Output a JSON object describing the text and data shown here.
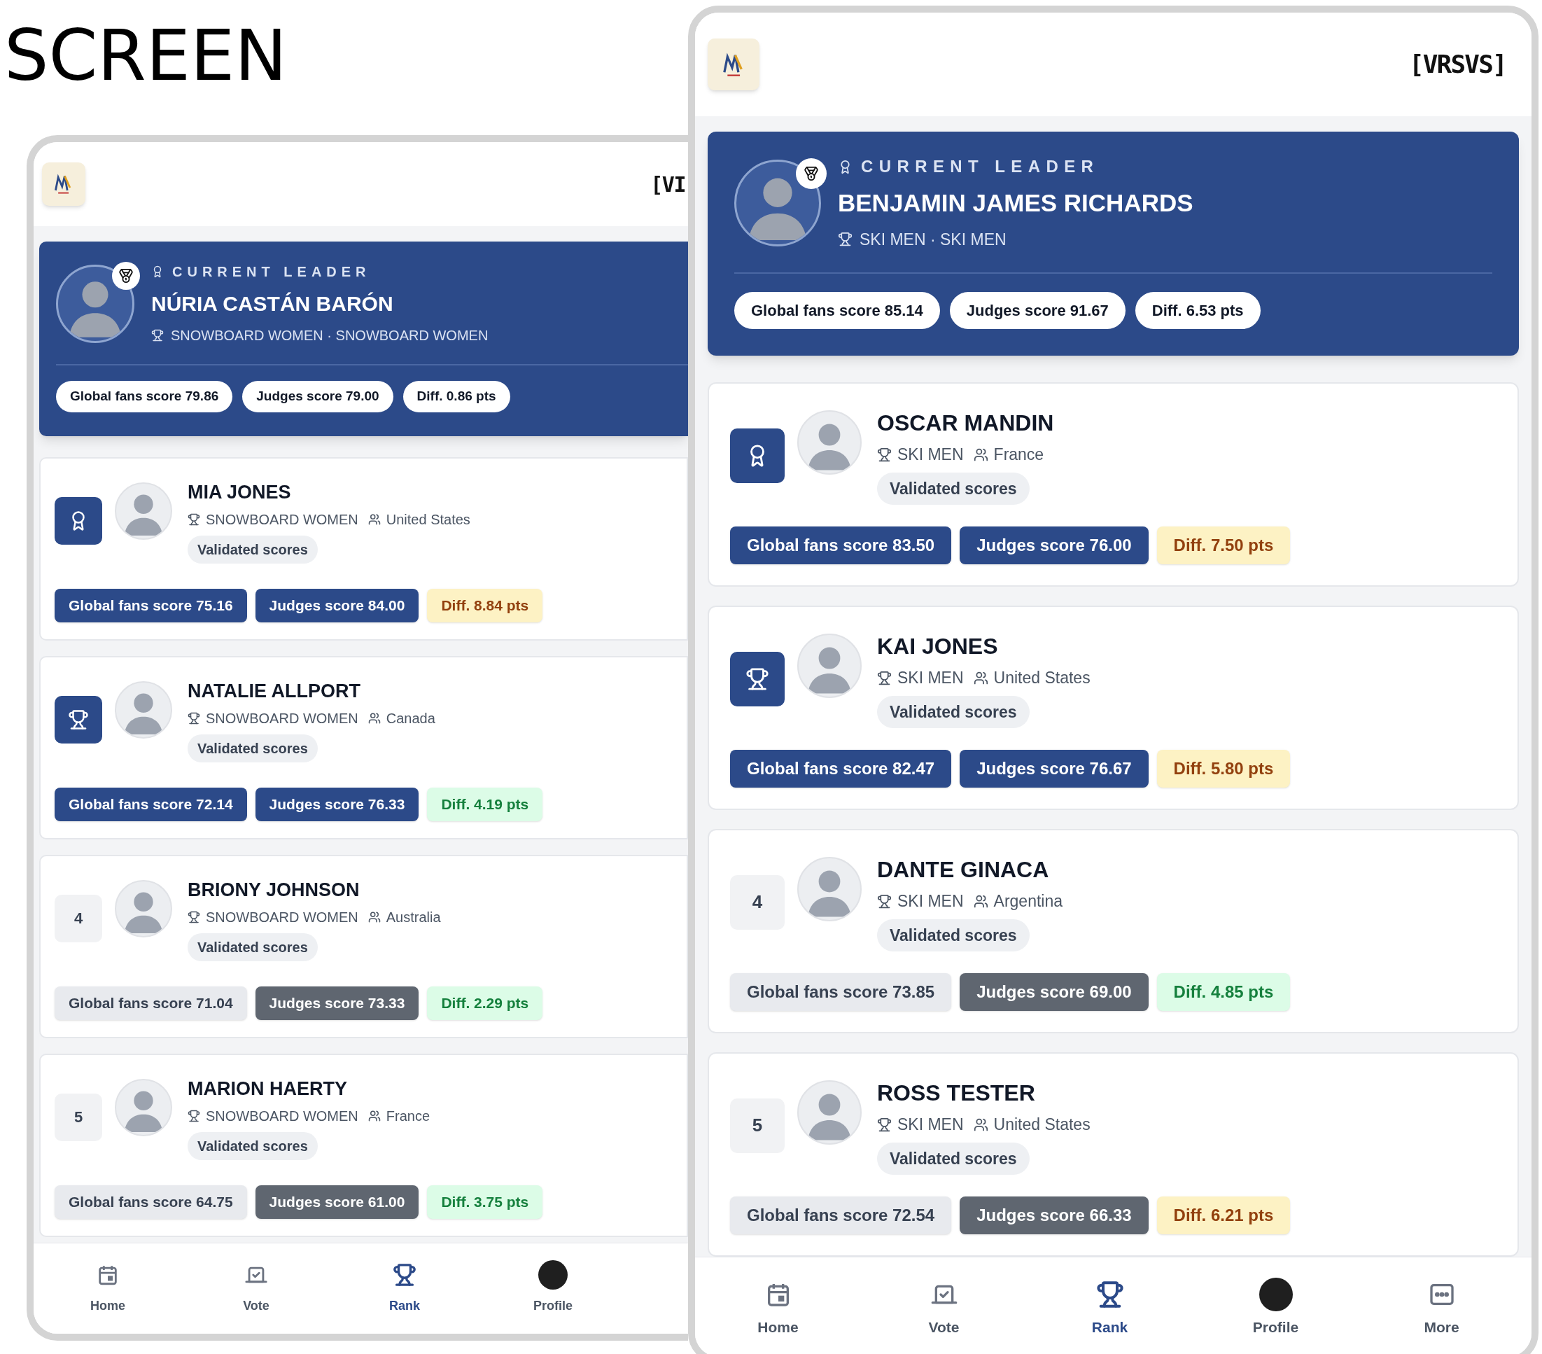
{
  "title": "SCREEN",
  "phones": [
    {
      "kind": "compact",
      "logo": "[VI",
      "leader": {
        "label": "CURRENT LEADER",
        "name": "NÚRIA CASTÁN BARÓN",
        "meta": "SNOWBOARD WOMEN · SNOWBOARD WOMEN",
        "scores": [
          "Global fans score 79.86",
          "Judges score 79.00",
          "Diff. 0.86 pts"
        ]
      },
      "rows": [
        {
          "rank": {
            "kind": "award"
          },
          "name": "MIA JONES",
          "sport": "SNOWBOARD WOMEN",
          "country": "United States",
          "status": "Validated scores",
          "global": {
            "text": "Global fans score 75.16",
            "kind": "blue"
          },
          "judges": {
            "text": "Judges score 84.00",
            "kind": "blue"
          },
          "diff": {
            "text": "Diff. 8.84 pts",
            "kind": "yellow"
          }
        },
        {
          "rank": {
            "kind": "trophy"
          },
          "name": "NATALIE ALLPORT",
          "sport": "SNOWBOARD WOMEN",
          "country": "Canada",
          "status": "Validated scores",
          "global": {
            "text": "Global fans score 72.14",
            "kind": "blue"
          },
          "judges": {
            "text": "Judges score 76.33",
            "kind": "blue"
          },
          "diff": {
            "text": "Diff. 4.19 pts",
            "kind": "green"
          }
        },
        {
          "rank": {
            "kind": "number",
            "label": "4"
          },
          "name": "BRIONY JOHNSON",
          "sport": "SNOWBOARD WOMEN",
          "country": "Australia",
          "status": "Validated scores",
          "global": {
            "text": "Global fans score 71.04",
            "kind": "light"
          },
          "judges": {
            "text": "Judges score 73.33",
            "kind": "dark"
          },
          "diff": {
            "text": "Diff. 2.29 pts",
            "kind": "green"
          }
        },
        {
          "rank": {
            "kind": "number",
            "label": "5"
          },
          "name": "MARION HAERTY",
          "sport": "SNOWBOARD WOMEN",
          "country": "France",
          "status": "Validated scores",
          "global": {
            "text": "Global fans score 64.75",
            "kind": "light"
          },
          "judges": {
            "text": "Judges score 61.00",
            "kind": "dark"
          },
          "diff": {
            "text": "Diff. 3.75 pts",
            "kind": "green"
          }
        }
      ],
      "nav": [
        {
          "kind": "calendar",
          "label": "Home",
          "selected": false
        },
        {
          "kind": "vote",
          "label": "Vote",
          "selected": false
        },
        {
          "kind": "trophy",
          "label": "Rank",
          "selected": true
        },
        {
          "kind": "avatar",
          "label": "Profile",
          "selected": false
        }
      ]
    },
    {
      "kind": "full",
      "logo": "[VRSVS]",
      "leader": {
        "label": "CURRENT LEADER",
        "name": "BENJAMIN JAMES RICHARDS",
        "meta": "SKI MEN · SKI MEN",
        "scores": [
          "Global fans score 85.14",
          "Judges score 91.67",
          "Diff. 6.53 pts"
        ]
      },
      "rows": [
        {
          "rank": {
            "kind": "award"
          },
          "name": "OSCAR MANDIN",
          "sport": "SKI MEN",
          "country": "France",
          "status": "Validated scores",
          "global": {
            "text": "Global fans score 83.50",
            "kind": "blue"
          },
          "judges": {
            "text": "Judges score 76.00",
            "kind": "blue"
          },
          "diff": {
            "text": "Diff. 7.50 pts",
            "kind": "yellow"
          }
        },
        {
          "rank": {
            "kind": "trophy"
          },
          "name": "KAI JONES",
          "sport": "SKI MEN",
          "country": "United States",
          "status": "Validated scores",
          "global": {
            "text": "Global fans score 82.47",
            "kind": "blue"
          },
          "judges": {
            "text": "Judges score 76.67",
            "kind": "blue"
          },
          "diff": {
            "text": "Diff. 5.80 pts",
            "kind": "yellow"
          }
        },
        {
          "rank": {
            "kind": "number",
            "label": "4"
          },
          "name": "DANTE GINACA",
          "sport": "SKI MEN",
          "country": "Argentina",
          "status": "Validated scores",
          "global": {
            "text": "Global fans score 73.85",
            "kind": "light"
          },
          "judges": {
            "text": "Judges score 69.00",
            "kind": "dark"
          },
          "diff": {
            "text": "Diff. 4.85 pts",
            "kind": "green"
          }
        },
        {
          "rank": {
            "kind": "number",
            "label": "5"
          },
          "name": "ROSS TESTER",
          "sport": "SKI MEN",
          "country": "United States",
          "status": "Validated scores",
          "global": {
            "text": "Global fans score 72.54",
            "kind": "light"
          },
          "judges": {
            "text": "Judges score 66.33",
            "kind": "dark"
          },
          "diff": {
            "text": "Diff. 6.21 pts",
            "kind": "yellow"
          }
        }
      ],
      "nav": [
        {
          "kind": "calendar",
          "label": "Home",
          "selected": false
        },
        {
          "kind": "vote",
          "label": "Vote",
          "selected": false
        },
        {
          "kind": "trophy",
          "label": "Rank",
          "selected": true
        },
        {
          "kind": "avatar",
          "label": "Profile",
          "selected": false
        },
        {
          "kind": "more",
          "label": "More",
          "selected": false
        }
      ]
    }
  ]
}
